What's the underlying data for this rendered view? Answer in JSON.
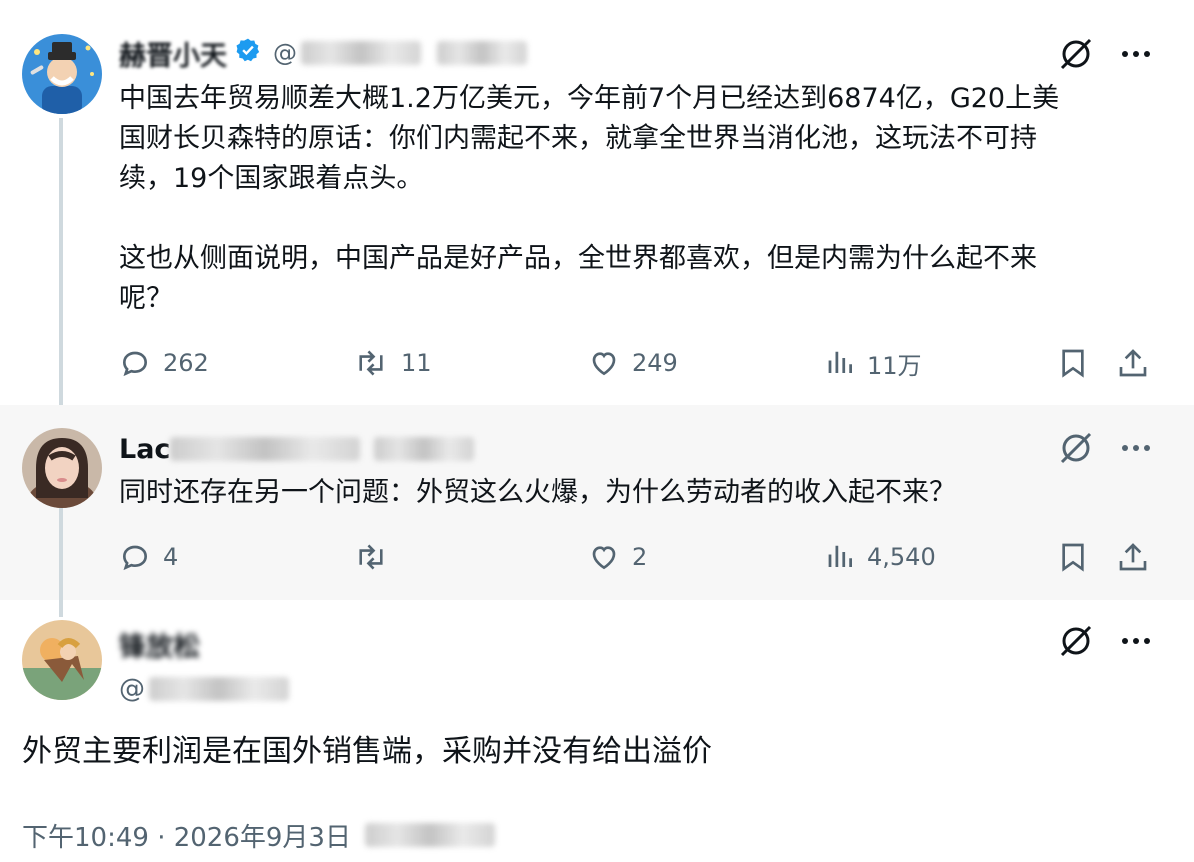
{
  "tweets": [
    {
      "display_name": "赫晋小天",
      "handle_partial": "@",
      "verified": true,
      "text": "中国去年贸易顺差大概1.2万亿美元，今年前7个月已经达到6874亿，G20上美\n国财长贝森特的原话：你们内需起不来，就拿全世界当消化池，这玩法不可持\n续，19个国家跟着点头。\n\n这也从侧面说明，中国产品是好产品，全世界都喜欢，但是内需为什么起不来\n呢？",
      "replies": "262",
      "reposts": "11",
      "likes": "249",
      "views": "11万"
    },
    {
      "display_name": "Lac",
      "text": "同时还存在另一个问题：外贸这么火爆，为什么劳动者的收入起不来？",
      "replies": "4",
      "reposts": "",
      "likes": "2",
      "views": "4,540"
    },
    {
      "display_name": "锋放松",
      "handle_partial": "@",
      "text": "外贸主要利润是在国外销售端，采购并没有给出溢价",
      "timestamp": "下午10:49 · 2026年9月3日"
    }
  ],
  "icons": {
    "grok": "grok-icon",
    "more": "more-icon",
    "reply": "reply-icon",
    "repost": "repost-icon",
    "like": "like-icon",
    "views": "views-icon",
    "bookmark": "bookmark-icon",
    "share": "share-icon",
    "verified": "verified-badge-icon"
  },
  "colors": {
    "text": "#0f1419",
    "secondary": "#536471",
    "verified": "#1d9bf0",
    "thread_line": "#cfd9de",
    "highlight_bg": "#f7f7f7"
  }
}
